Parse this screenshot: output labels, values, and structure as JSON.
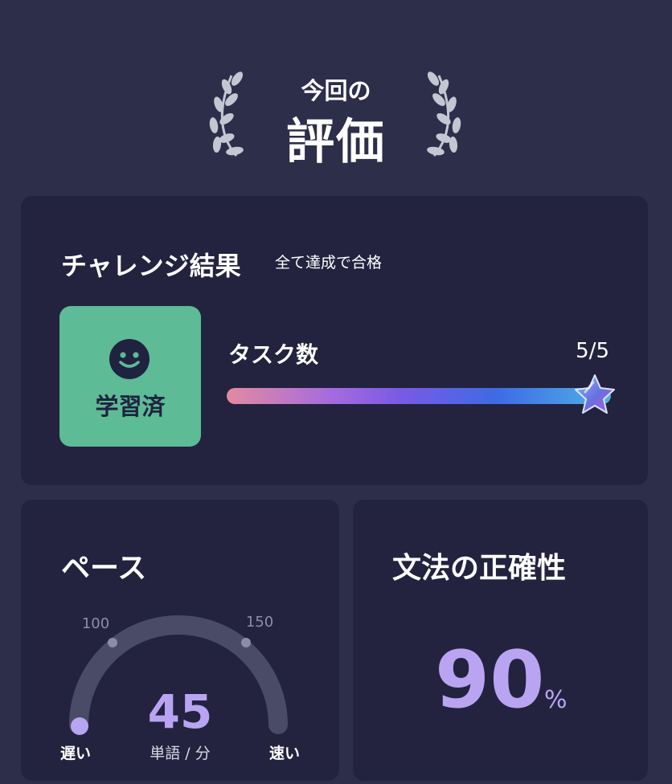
{
  "header": {
    "subtitle": "今回の",
    "title": "評価"
  },
  "challenge": {
    "title": "チャレンジ結果",
    "note": "全て達成で合格",
    "status_label": "学習済",
    "task_label": "タスク数",
    "task_count": "5/5",
    "progress": 1.0
  },
  "pace": {
    "title": "ペース",
    "value": "45",
    "unit": "単語 / 分",
    "tick_low": "100",
    "tick_high": "150",
    "label_slow": "遅い",
    "label_fast": "速い"
  },
  "grammar": {
    "title": "文法の正確性",
    "value": "90",
    "unit": "%"
  },
  "colors": {
    "background": "#2d2e4a",
    "card": "#23233f",
    "status_green": "#5dbb96",
    "accent_purple": "#b9a4f2"
  },
  "icons": {
    "laurel_left": "laurel-left-icon",
    "laurel_right": "laurel-right-icon",
    "status": "smile-icon",
    "progress_end": "star-icon"
  }
}
